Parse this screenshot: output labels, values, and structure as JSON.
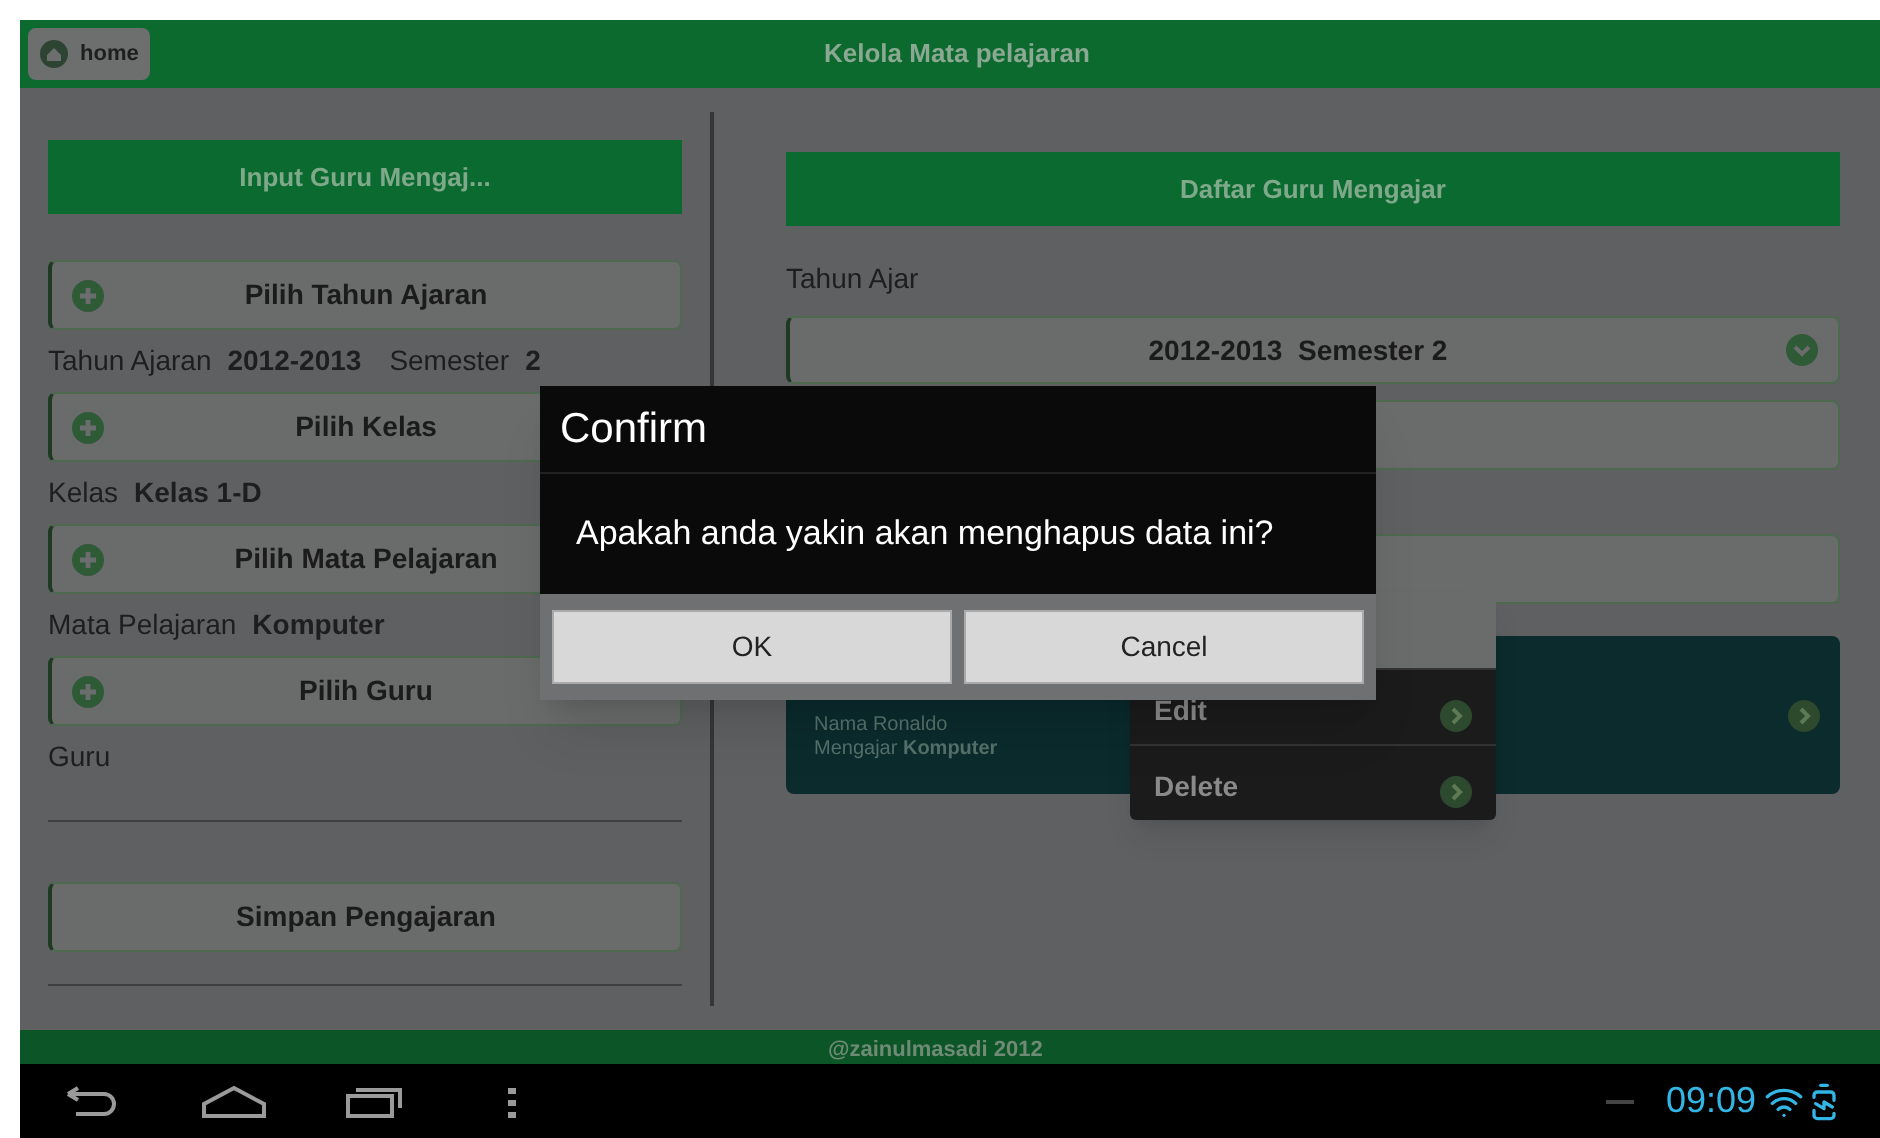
{
  "top_bar": {
    "home_button": "home",
    "title": "Kelola Mata pelajaran"
  },
  "left_panel": {
    "header": "Input Guru Mengaj...",
    "items": [
      {
        "kind": "pick",
        "label": "Pilih Tahun Ajaran"
      },
      {
        "kind": "info",
        "parts": [
          {
            "text": "Tahun Ajaran",
            "bold": false
          },
          {
            "text": "2012-2013",
            "bold": true
          },
          {
            "text": "Semester",
            "bold": false
          },
          {
            "text": "2",
            "bold": true
          }
        ]
      },
      {
        "kind": "pick",
        "label": "Pilih Kelas"
      },
      {
        "kind": "info",
        "parts": [
          {
            "text": "Kelas",
            "bold": false
          },
          {
            "text": "Kelas 1-D",
            "bold": true
          }
        ]
      },
      {
        "kind": "pick",
        "label": "Pilih Mata Pelajaran"
      },
      {
        "kind": "info",
        "parts": [
          {
            "text": "Mata Pelajaran",
            "bold": false
          },
          {
            "text": "Komputer",
            "bold": true
          }
        ]
      },
      {
        "kind": "pick",
        "label": "Pilih Guru"
      },
      {
        "kind": "info",
        "parts": [
          {
            "text": "Guru",
            "bold": false
          }
        ]
      },
      {
        "kind": "rule"
      },
      {
        "kind": "save",
        "label": "Simpan Pengajaran"
      },
      {
        "kind": "rule"
      }
    ]
  },
  "right_panel": {
    "header": "Daftar Guru Mengajar",
    "year_label": "Tahun Ajar",
    "year_select": "2012-2013  Semester 2",
    "card": {
      "lines": [
        "Nama Ronaldo",
        "Mengajar **Komputer**"
      ]
    }
  },
  "context_menu": {
    "items": [
      "Edit",
      "Delete"
    ]
  },
  "dialog": {
    "title": "Confirm",
    "message": "Apakah anda yakin akan menghapus data ini?",
    "buttons": [
      "OK",
      "Cancel"
    ]
  },
  "footer": "@zainulmasadi 2012",
  "nav_bar": {
    "time": "09:09"
  }
}
